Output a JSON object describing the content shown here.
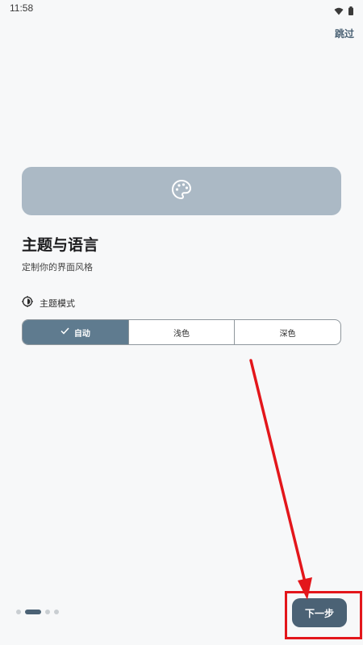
{
  "status_bar": {
    "time": "11:58"
  },
  "header": {
    "skip_label": "跳过"
  },
  "hero": {
    "icon": "palette-icon"
  },
  "page": {
    "title": "主题与语言",
    "subtitle": "定制你的界面风格"
  },
  "theme_section": {
    "icon": "brightness-icon",
    "label": "主题模式",
    "options": [
      {
        "label": "自动",
        "selected": true
      },
      {
        "label": "浅色",
        "selected": false
      },
      {
        "label": "深色",
        "selected": false
      }
    ]
  },
  "pager": {
    "total": 4,
    "current_index": 1
  },
  "footer": {
    "next_label": "下一步"
  },
  "colors": {
    "accent": "#4b6275",
    "hero_bg": "#abb9c5",
    "selected_segment": "#5f7b8f",
    "annotation_red": "#e3161b",
    "background": "#f7f8f9"
  }
}
